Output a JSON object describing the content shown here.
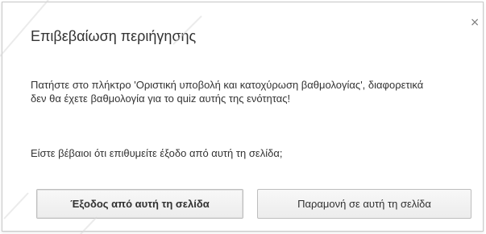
{
  "dialog": {
    "title": "Επιβεβαίωση περιήγησης",
    "close_symbol": "×",
    "message": "Πατήστε στο πλήκτρο 'Οριστική υποβολή και κατοχύρωση βαθμολογίας', διαφορετικά δεν θα έχετε βαθμολογία για το quiz αυτής της ενότητας!",
    "question": "Είστε βέβαιοι ότι επιθυμείτε έξοδο από αυτή τη σελίδα;",
    "buttons": {
      "leave_label": "Έξοδος από αυτή τη σελίδα",
      "stay_label": "Παραμονή σε αυτή τη σελίδα"
    }
  },
  "icons": {
    "close": "close-icon"
  },
  "colors": {
    "background": "#ffffff",
    "border": "#c9c9c9",
    "text": "#333333",
    "button_bg": "#f1f1f1"
  }
}
